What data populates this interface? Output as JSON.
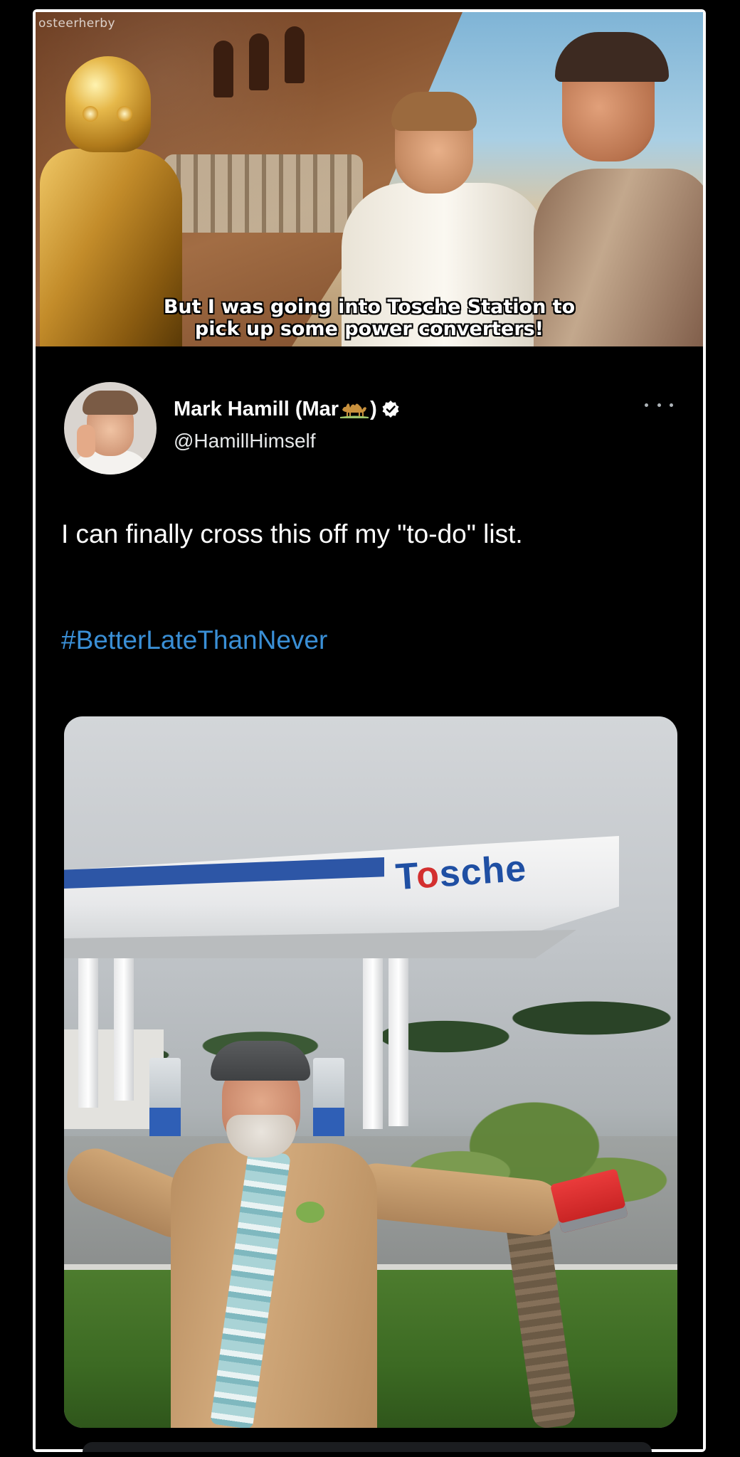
{
  "meme": {
    "watermark": "osteerherby",
    "subtitle_line1": "But I was going into Tosche Station to",
    "subtitle_line2": "pick up some power converters!"
  },
  "tweet": {
    "display_name_prefix": "Mark Hamill (Mar",
    "display_name_suffix": ")",
    "name_emoji": "camel-icon",
    "verified_icon": "verified-badge-icon",
    "handle": "@HamillHimself",
    "more_icon": "more-options-icon",
    "text": "I can finally cross this off my \"to-do\" list.",
    "hashtag": "#BetterLateThanNever",
    "hashtag_color": "#3a8fd6"
  },
  "photo": {
    "sign_text": "Tosche",
    "sign_text_color": "#1f4fa3",
    "sign_accent_color": "#d32f2f"
  }
}
